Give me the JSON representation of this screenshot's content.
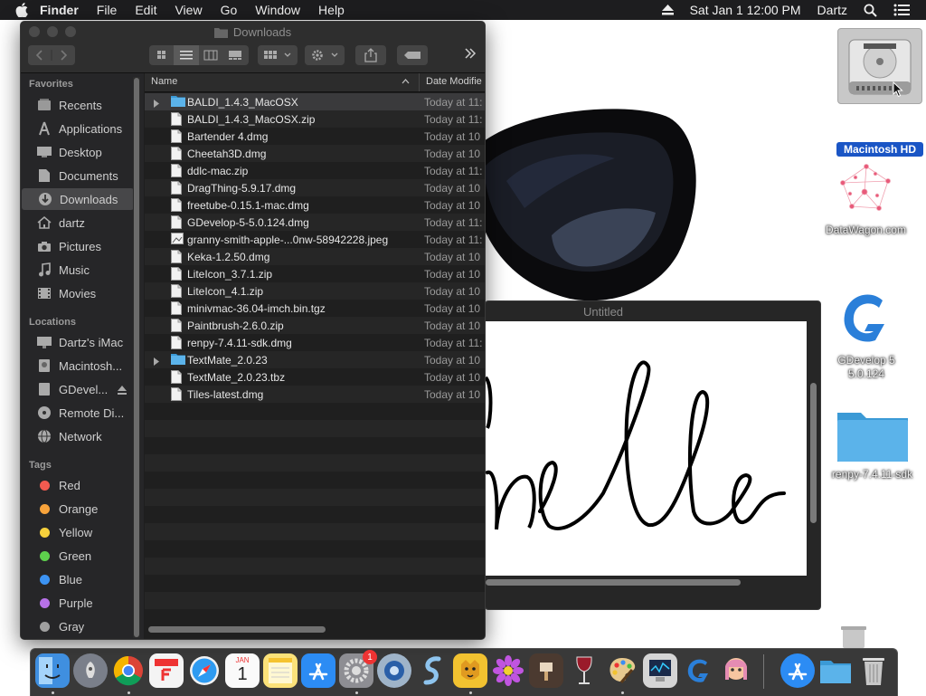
{
  "menubar": {
    "app_name": "Finder",
    "items": [
      "File",
      "Edit",
      "View",
      "Go",
      "Window",
      "Help"
    ],
    "datetime": "Sat Jan 1  12:00 PM",
    "user": "Dartz"
  },
  "finder": {
    "title": "Downloads",
    "columns": {
      "name": "Name",
      "date": "Date Modifie"
    },
    "sidebar": {
      "favorites_header": "Favorites",
      "favorites": [
        "Recents",
        "Applications",
        "Desktop",
        "Documents",
        "Downloads",
        "dartz",
        "Pictures",
        "Music",
        "Movies"
      ],
      "locations_header": "Locations",
      "locations": [
        "Dartz's iMac",
        "Macintosh...",
        "GDevel...",
        "Remote Di...",
        "Network"
      ],
      "tags_header": "Tags",
      "tags": [
        {
          "label": "Red",
          "color": "#f35a50"
        },
        {
          "label": "Orange",
          "color": "#f8a33b"
        },
        {
          "label": "Yellow",
          "color": "#f6d03c"
        },
        {
          "label": "Green",
          "color": "#5ed14d"
        },
        {
          "label": "Blue",
          "color": "#3c93f3"
        },
        {
          "label": "Purple",
          "color": "#b771e8"
        },
        {
          "label": "Gray",
          "color": "#a0a0a0"
        }
      ]
    },
    "files": [
      {
        "name": "BALDI_1.4.3_MacOSX",
        "date": "Today at 11:",
        "kind": "folder"
      },
      {
        "name": "BALDI_1.4.3_MacOSX.zip",
        "date": "Today at 11:",
        "kind": "file"
      },
      {
        "name": "Bartender 4.dmg",
        "date": "Today at 10",
        "kind": "file"
      },
      {
        "name": "Cheetah3D.dmg",
        "date": "Today at 10",
        "kind": "file"
      },
      {
        "name": "ddlc-mac.zip",
        "date": "Today at 11:",
        "kind": "file"
      },
      {
        "name": "DragThing-5.9.17.dmg",
        "date": "Today at 10",
        "kind": "file"
      },
      {
        "name": "freetube-0.15.1-mac.dmg",
        "date": "Today at 10",
        "kind": "file"
      },
      {
        "name": "GDevelop-5-5.0.124.dmg",
        "date": "Today at 11:",
        "kind": "file"
      },
      {
        "name": "granny-smith-apple-...0nw-58942228.jpeg",
        "date": "Today at 11:",
        "kind": "image"
      },
      {
        "name": "Keka-1.2.50.dmg",
        "date": "Today at 10",
        "kind": "file"
      },
      {
        "name": "LiteIcon_3.7.1.zip",
        "date": "Today at 10",
        "kind": "file"
      },
      {
        "name": "LiteIcon_4.1.zip",
        "date": "Today at 10",
        "kind": "file"
      },
      {
        "name": "minivmac-36.04-imch.bin.tgz",
        "date": "Today at 10",
        "kind": "file"
      },
      {
        "name": "Paintbrush-2.6.0.zip",
        "date": "Today at 10",
        "kind": "file"
      },
      {
        "name": "renpy-7.4.11-sdk.dmg",
        "date": "Today at 11:",
        "kind": "file"
      },
      {
        "name": "TextMate_2.0.23",
        "date": "Today at 10",
        "kind": "folder"
      },
      {
        "name": "TextMate_2.0.23.tbz",
        "date": "Today at 10",
        "kind": "file"
      },
      {
        "name": "Tiles-latest.dmg",
        "date": "Today at 10",
        "kind": "file"
      }
    ]
  },
  "paint_window": {
    "title": "Untitled",
    "drawn_text": "hello"
  },
  "desktop": {
    "icons": [
      "Macintosh HD",
      "DataWagon.com",
      "GDevelop 5\n5.0.124",
      "renpy-7.4.11-sdk"
    ]
  },
  "dock": {
    "apps": [
      "Finder",
      "Launchpad",
      "Chrome",
      "Fantastical",
      "Safari",
      "Calendar",
      "Notes",
      "App Store",
      "System Preferences",
      "Screen Saver",
      "Alfred",
      "Cheetah3D",
      "Flower",
      "Keynote",
      "Wine",
      "Paintbrush",
      "Activity Monitor",
      "GDevelop",
      "Ren'Py",
      "App Store",
      "Downloads",
      "Trash"
    ],
    "calendar_month": "JAN",
    "calendar_day": "1",
    "badge_count": "1"
  }
}
